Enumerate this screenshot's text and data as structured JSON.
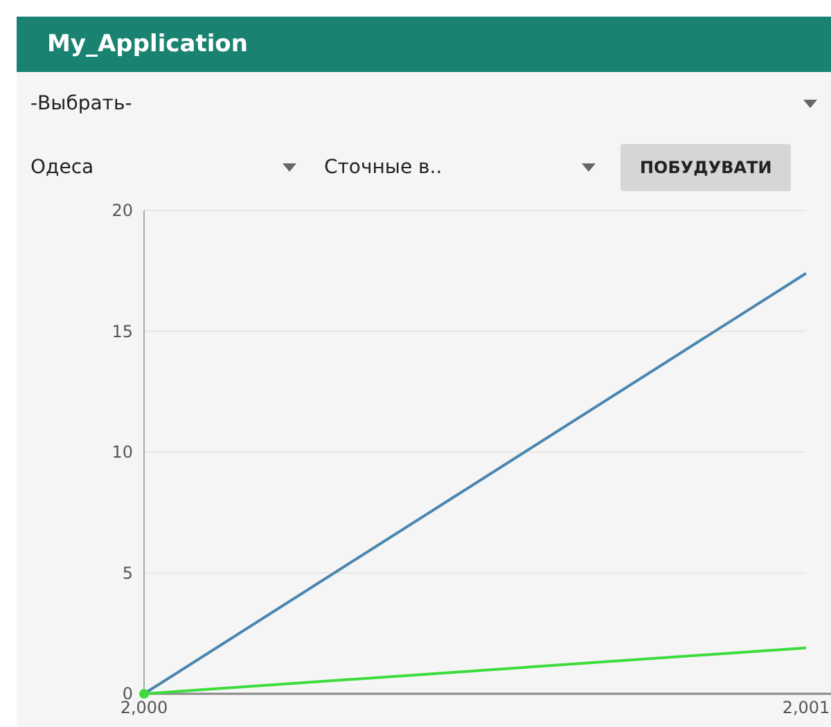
{
  "app_bar": {
    "title": "My_Application"
  },
  "selector": {
    "value": "-Выбрать-"
  },
  "filters": [
    {
      "value": "Одеса"
    },
    {
      "value": "Сточные в.."
    }
  ],
  "build_button": {
    "label": "ПОБУДУВАТИ"
  },
  "chart": {
    "chart_data": {
      "type": "line",
      "x": [
        2000,
        2001
      ],
      "xlim": [
        2000,
        2001
      ],
      "ylim": [
        0,
        20
      ],
      "xticks": [
        {
          "value": 2000,
          "label": "2,000"
        },
        {
          "value": 2001,
          "label": "2,001"
        }
      ],
      "yticks": [
        0,
        5,
        10,
        15,
        20
      ],
      "grid": true,
      "series": [
        {
          "color": "#4a86b0",
          "values": [
            0,
            17.4
          ]
        },
        {
          "color": "#3ddc3d",
          "values": [
            0,
            1.9
          ]
        }
      ]
    }
  }
}
